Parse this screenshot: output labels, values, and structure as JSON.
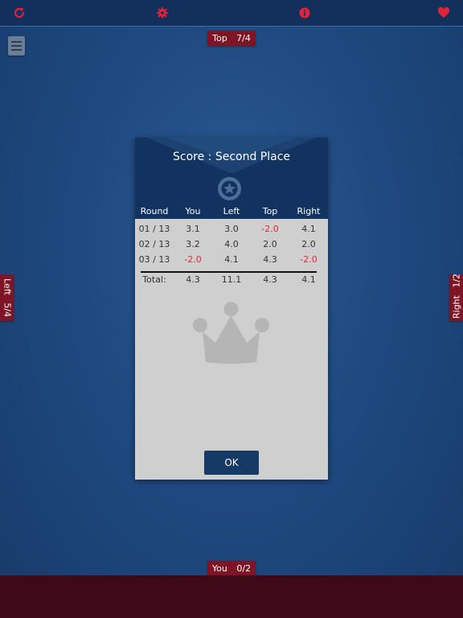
{
  "toolbar": {
    "icons": [
      "refresh-icon",
      "gear-icon",
      "info-icon",
      "heart-icon"
    ],
    "icon_color": "#e0233a"
  },
  "players": {
    "top": {
      "name": "Top",
      "score": "7/4"
    },
    "left": {
      "name": "Left",
      "score": "5/4"
    },
    "right": {
      "name": "Right",
      "score": "1/2"
    },
    "you": {
      "name": "You",
      "score": "0/2"
    }
  },
  "dialog": {
    "title": "Score : Second Place",
    "columns": [
      "Round",
      "You",
      "Left",
      "Top",
      "Right"
    ],
    "rows": [
      {
        "round": "01 / 13",
        "you": "3.1",
        "left": "3.0",
        "top": "-2.0",
        "right": "4.1"
      },
      {
        "round": "02 / 13",
        "you": "3.2",
        "left": "4.0",
        "top": "2.0",
        "right": "2.0"
      },
      {
        "round": "03 / 13",
        "you": "-2.0",
        "left": "4.1",
        "top": "4.3",
        "right": "-2.0"
      }
    ],
    "totals": {
      "label": "Total:",
      "you": "4.3",
      "left": "11.1",
      "top": "4.3",
      "right": "4.1"
    },
    "ok_label": "OK",
    "negative_color": "#e0262c"
  }
}
